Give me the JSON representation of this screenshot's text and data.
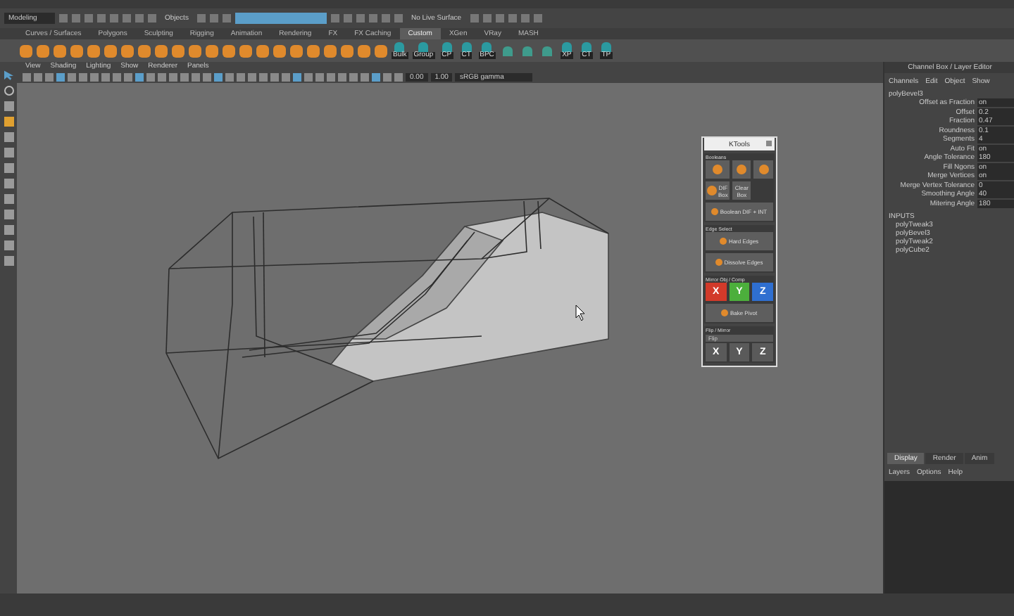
{
  "status_line": {
    "mode": "Modeling",
    "selection_mode": "Objects",
    "live_surface": "No Live Surface"
  },
  "shelf_tabs": [
    {
      "label": "Curves / Surfaces",
      "selected": false
    },
    {
      "label": "Polygons",
      "selected": false
    },
    {
      "label": "Sculpting",
      "selected": false
    },
    {
      "label": "Rigging",
      "selected": false
    },
    {
      "label": "Animation",
      "selected": false
    },
    {
      "label": "Rendering",
      "selected": false
    },
    {
      "label": "FX",
      "selected": false
    },
    {
      "label": "FX Caching",
      "selected": false
    },
    {
      "label": "Custom",
      "selected": true
    },
    {
      "label": "XGen",
      "selected": false
    },
    {
      "label": "VRay",
      "selected": false
    },
    {
      "label": "MASH",
      "selected": false
    }
  ],
  "shelf_tools": [
    {
      "kind": "labeled",
      "label": "Bulk"
    },
    {
      "kind": "labeled",
      "label": "Group"
    },
    {
      "kind": "labeled",
      "label": "CP"
    },
    {
      "kind": "labeled",
      "label": "CT"
    },
    {
      "kind": "labeled",
      "label": "BPC"
    },
    {
      "kind": "plain"
    },
    {
      "kind": "plain"
    },
    {
      "kind": "plain"
    },
    {
      "kind": "labeled",
      "label": "XP"
    },
    {
      "kind": "labeled",
      "label": "CT"
    },
    {
      "kind": "labeled",
      "label": "TP"
    }
  ],
  "viewport": {
    "menus": [
      "View",
      "Shading",
      "Lighting",
      "Show",
      "Renderer",
      "Panels"
    ],
    "exposure": "0.00",
    "gamma": "1.00",
    "color_space": "sRGB gamma"
  },
  "ktools": {
    "title": "KTools",
    "sections": [
      {
        "title": "Booleans",
        "buttons": [
          {
            "kind": "icon"
          },
          {
            "kind": "icon"
          },
          {
            "kind": "icon"
          },
          {
            "kind": "icon",
            "label": "DIF Box"
          },
          {
            "kind": "text",
            "label": "Clear Box"
          },
          {
            "kind": "wide",
            "label": "Boolean DIF + INT"
          }
        ]
      },
      {
        "title": "Edge Select",
        "buttons": [
          {
            "kind": "wide",
            "label": "Hard Edges"
          },
          {
            "kind": "wide",
            "label": "Dissolve Edges"
          }
        ]
      },
      {
        "title": "Mirror Obj / Comp",
        "buttons": [
          {
            "kind": "axis",
            "label": "X",
            "color": "#d23a2a"
          },
          {
            "kind": "axis",
            "label": "Y",
            "color": "#4caf3c"
          },
          {
            "kind": "axis",
            "label": "Z",
            "color": "#2f6fd0"
          },
          {
            "kind": "wide",
            "label": "Bake Pivot"
          }
        ]
      },
      {
        "title": "Flip / Mirror",
        "dropdown": "Flip",
        "buttons": [
          {
            "kind": "axis",
            "label": "X",
            "color": "#5a5a5a"
          },
          {
            "kind": "axis",
            "label": "Y",
            "color": "#5a5a5a"
          },
          {
            "kind": "axis",
            "label": "Z",
            "color": "#5a5a5a"
          }
        ]
      }
    ]
  },
  "channel_box": {
    "title": "Channel Box / Layer Editor",
    "menus": [
      "Channels",
      "Edit",
      "Object",
      "Show"
    ],
    "node": "polyBevel3",
    "attributes": [
      {
        "name": "Offset as Fraction",
        "value": "on"
      },
      {
        "name": "Offset",
        "value": "0.2"
      },
      {
        "name": "Fraction",
        "value": "0.47"
      },
      {
        "name": "Roundness",
        "value": "0.1"
      },
      {
        "name": "Segments",
        "value": "4"
      },
      {
        "name": "Auto Fit",
        "value": "on"
      },
      {
        "name": "Angle Tolerance",
        "value": "180"
      },
      {
        "name": "Fill Ngons",
        "value": "on"
      },
      {
        "name": "Merge Vertices",
        "value": "on"
      },
      {
        "name": "Merge Vertex Tolerance",
        "value": "0"
      },
      {
        "name": "Smoothing Angle",
        "value": "40"
      },
      {
        "name": "Mitering Angle",
        "value": "180"
      }
    ],
    "inputs_label": "INPUTS",
    "inputs": [
      "polyTweak3",
      "polyBevel3",
      "polyTweak2",
      "polyCube2"
    ]
  },
  "layer_editor": {
    "tabs": [
      {
        "label": "Display",
        "selected": true
      },
      {
        "label": "Render",
        "selected": false
      },
      {
        "label": "Anim",
        "selected": false
      }
    ],
    "menus": [
      "Layers",
      "Options",
      "Help"
    ]
  }
}
